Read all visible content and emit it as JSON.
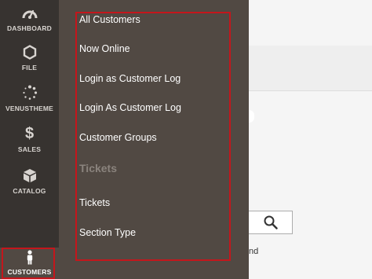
{
  "nav": {
    "items": [
      {
        "label": "DASHBOARD",
        "icon": "dashboard-icon"
      },
      {
        "label": "FILE",
        "icon": "hexagon-icon"
      },
      {
        "label": "VENUSTHEME",
        "icon": "spinner-dots-icon"
      },
      {
        "label": "SALES",
        "icon": "dollar-icon"
      },
      {
        "label": "CATALOG",
        "icon": "box-icon"
      },
      {
        "label": "CUSTOMERS",
        "icon": "person-icon",
        "active": true
      }
    ]
  },
  "flyout": {
    "items": [
      {
        "label": "All Customers"
      },
      {
        "label": "Now Online"
      },
      {
        "label": "Login as Customer Log"
      },
      {
        "label": "Login As Customer Log"
      },
      {
        "label": "Customer Groups"
      }
    ],
    "group_title": "Tickets",
    "group_items": [
      {
        "label": "Tickets"
      },
      {
        "label": "Section Type"
      }
    ]
  },
  "background": {
    "search_icon": "magnifier-icon",
    "partial_text": "nd"
  },
  "colors": {
    "nav_bg": "#373330",
    "flyout_bg": "#514943",
    "highlight": "#c4161c"
  }
}
